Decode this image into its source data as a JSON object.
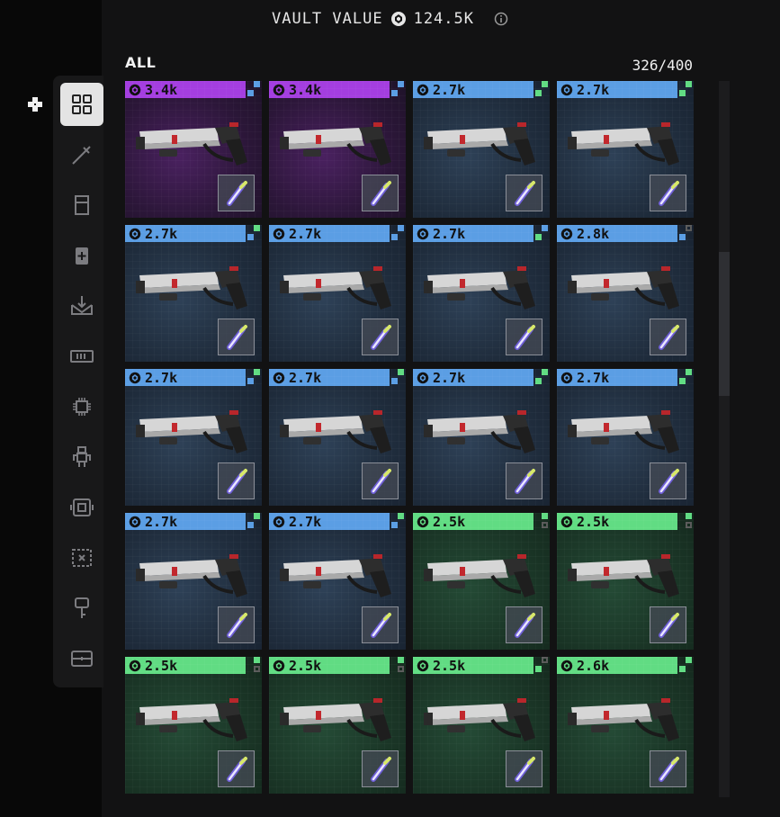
{
  "header": {
    "vault_label": "VAULT VALUE",
    "vault_value": "124.5K",
    "coin_icon": "coin-icon",
    "info_icon": "info-icon"
  },
  "filter": {
    "label": "ALL"
  },
  "capacity": "326/400",
  "sidebar": {
    "items": [
      {
        "name": "grid-icon",
        "active": true
      },
      {
        "name": "sword-icon",
        "active": false
      },
      {
        "name": "helmet-icon",
        "active": false
      },
      {
        "name": "chest-armor-icon",
        "active": false
      },
      {
        "name": "inbox-icon",
        "active": false
      },
      {
        "name": "ammo-icon",
        "active": false
      },
      {
        "name": "chip-icon",
        "active": false
      },
      {
        "name": "robot-icon",
        "active": false
      },
      {
        "name": "frame-icon",
        "active": false
      },
      {
        "name": "crate-x-icon",
        "active": false
      },
      {
        "name": "key-icon",
        "active": false
      },
      {
        "name": "toolbox-icon",
        "active": false
      }
    ]
  },
  "colors": {
    "purple": "#a43ee0",
    "blue": "#5b9ee4",
    "green": "#61dc83",
    "pip_blue": "#5b9ee4",
    "pip_green": "#61dc83",
    "pip_gray": "#5a5a5a"
  },
  "items": [
    {
      "price": "3.4k",
      "rarity": "purple",
      "pips": [
        "blue",
        "blue",
        "empty"
      ]
    },
    {
      "price": "3.4k",
      "rarity": "purple",
      "pips": [
        "blue",
        "blue",
        "empty"
      ]
    },
    {
      "price": "2.7k",
      "rarity": "blue",
      "pips": [
        "green",
        "green",
        "empty"
      ]
    },
    {
      "price": "2.7k",
      "rarity": "blue",
      "pips": [
        "green",
        "green",
        "empty"
      ]
    },
    {
      "price": "2.7k",
      "rarity": "blue",
      "pips": [
        "green",
        "blue",
        "empty"
      ]
    },
    {
      "price": "2.7k",
      "rarity": "blue",
      "pips": [
        "blue",
        "blue",
        "empty"
      ]
    },
    {
      "price": "2.7k",
      "rarity": "blue",
      "pips": [
        "blue",
        "green",
        "empty"
      ]
    },
    {
      "price": "2.8k",
      "rarity": "blue",
      "pips": [
        "gray",
        "blue",
        "empty"
      ]
    },
    {
      "price": "2.7k",
      "rarity": "blue",
      "pips": [
        "green",
        "blue",
        "empty"
      ]
    },
    {
      "price": "2.7k",
      "rarity": "blue",
      "pips": [
        "green",
        "blue",
        "empty"
      ]
    },
    {
      "price": "2.7k",
      "rarity": "blue",
      "pips": [
        "green",
        "green",
        "empty"
      ]
    },
    {
      "price": "2.7k",
      "rarity": "blue",
      "pips": [
        "green",
        "green",
        "empty"
      ]
    },
    {
      "price": "2.7k",
      "rarity": "blue",
      "pips": [
        "green",
        "blue",
        "empty"
      ]
    },
    {
      "price": "2.7k",
      "rarity": "blue",
      "pips": [
        "green",
        "blue",
        "empty"
      ]
    },
    {
      "price": "2.5k",
      "rarity": "green",
      "pips": [
        "green",
        "empty",
        "gray"
      ]
    },
    {
      "price": "2.5k",
      "rarity": "green",
      "pips": [
        "green",
        "empty",
        "gray"
      ]
    },
    {
      "price": "2.5k",
      "rarity": "green",
      "pips": [
        "green",
        "empty",
        "gray"
      ]
    },
    {
      "price": "2.5k",
      "rarity": "green",
      "pips": [
        "green",
        "empty",
        "gray"
      ]
    },
    {
      "price": "2.5k",
      "rarity": "green",
      "pips": [
        "gray",
        "green",
        "empty"
      ]
    },
    {
      "price": "2.6k",
      "rarity": "green",
      "pips": [
        "green",
        "green",
        "empty"
      ]
    }
  ]
}
